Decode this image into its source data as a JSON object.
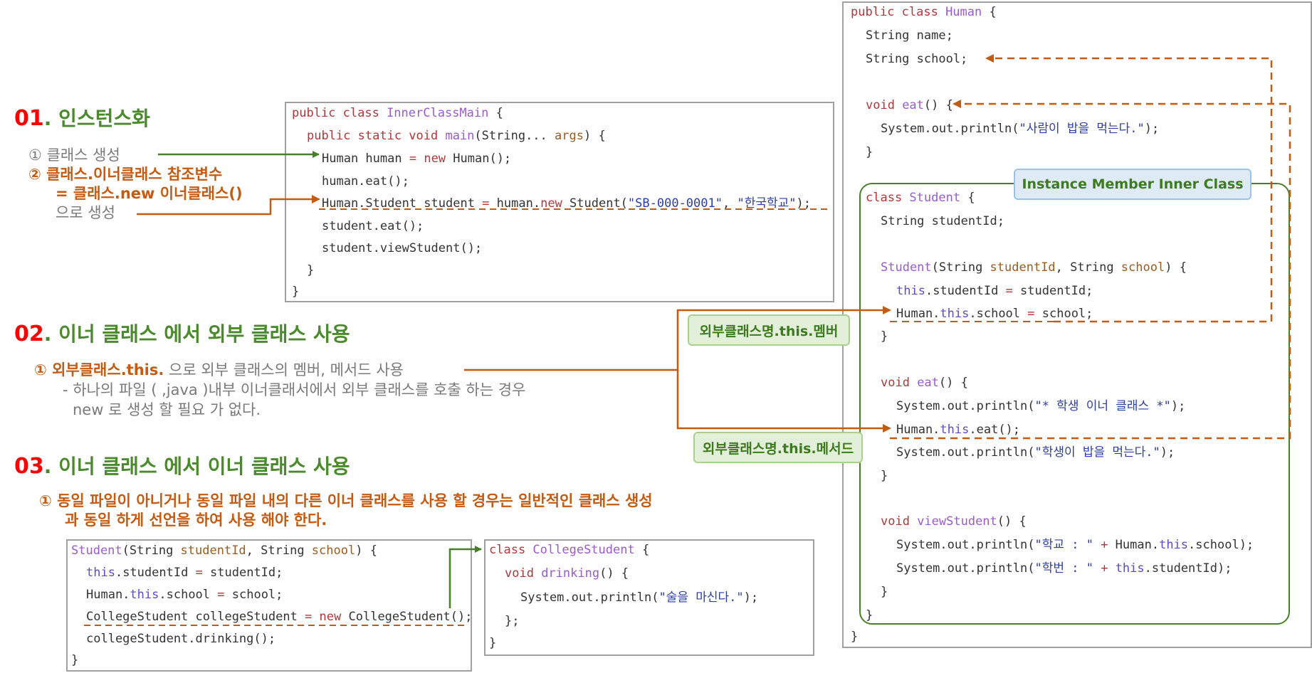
{
  "sections": {
    "s1": {
      "num": "01",
      "title": ". 인스턴스화",
      "item1": "① 클래스 생성",
      "item2_line1": "② 클래스.이너클래스 참조변수",
      "item2_line2": "= 클래스.new 이너클래스()",
      "item2_line3": "으로 생성"
    },
    "s2": {
      "num": "02",
      "title": ". 이너 클래스 에서 외부 클래스 사용",
      "item1_prefix": "① 외부클래스.this.",
      "item1_rest": " 으로 외부 클래스의 멤버, 메서드 사용",
      "note1": "- 하나의 파일 ( ,java )내부 이너클래서에서 외부 클래스를 호출 하는 경우",
      "note2": "new 로 생성 할 필요 가 없다."
    },
    "s3": {
      "num": "03",
      "title": ". 이너 클래스 에서 이너 클래스 사용",
      "item1_line1": "① 동일 파일이 아니거나 동일 파일 내의 다른 이너 클래스를 사용 할 경우는 일반적인 클래스 생성",
      "item1_line2": "과 동일 하게 선언을 하여 사용 해야 한다."
    }
  },
  "labels": {
    "instance_inner": "Instance Member Inner Class",
    "outer_member": "외부클래스명.this.멤버",
    "outer_method": "외부클래스명.this.메서드"
  },
  "code": {
    "main": {
      "l1": [
        "public class ",
        "InnerClassMain",
        " {"
      ],
      "l2": [
        "public static void ",
        "main",
        "(String... ",
        "args",
        ") {"
      ],
      "l3": [
        "Human human ",
        "=",
        " ",
        "new",
        " Human();"
      ],
      "l4": "human.eat();",
      "l5": [
        "Human.Student student ",
        "=",
        " human.",
        "new",
        " Student(",
        "\"SB-000-0001\"",
        ", ",
        "\"한국학교\"",
        ");"
      ],
      "l6": "student.eat();",
      "l7": "student.viewStudent();",
      "l8": "}",
      "l9": "}"
    },
    "human": {
      "l1": [
        "public class ",
        "Human",
        " {"
      ],
      "l2": "String name;",
      "l3": "String school;",
      "l4": [
        "void ",
        "eat",
        "() {"
      ],
      "l5": [
        "System.out.println(",
        "\"사람이 밥을 먹는다.\"",
        ");"
      ],
      "l6": "}",
      "l7": [
        "class ",
        "Student",
        " {"
      ],
      "l8": "String studentId;",
      "l9": [
        "Student",
        "(String ",
        "studentId",
        ", String ",
        "school",
        ") {"
      ],
      "l10": [
        "this",
        ".studentId ",
        "=",
        " studentId;"
      ],
      "l11": [
        "Human.",
        "this",
        ".school ",
        "=",
        " school;"
      ],
      "l12": "}",
      "l13": [
        "void ",
        "eat",
        "() {"
      ],
      "l14": [
        "System.out.println(",
        "\"* 학생 이너 클래스 *\"",
        ");"
      ],
      "l15": [
        "Human.",
        "this",
        ".eat();"
      ],
      "l16": [
        "System.out.println(",
        "\"학생이 밥을 먹는다.\"",
        ");"
      ],
      "l17": "}",
      "l18": [
        "void ",
        "viewStudent",
        "() {"
      ],
      "l19": [
        "System.out.println(",
        "\"학교 : \"",
        " ",
        "+",
        " Human.",
        "this",
        ".school);"
      ],
      "l20": [
        "System.out.println(",
        "\"학번 : \"",
        " ",
        "+",
        " ",
        "this",
        ".studentId);"
      ],
      "l21": "}",
      "l22": "}",
      "l23": "}"
    },
    "student": {
      "l1": [
        "Student",
        "(String ",
        "studentId",
        ", String ",
        "school",
        ") {"
      ],
      "l2": [
        "this",
        ".studentId ",
        "=",
        " studentId;"
      ],
      "l3": [
        "Human.",
        "this",
        ".school ",
        "=",
        " school;"
      ],
      "l4": [
        "CollegeStudent collegeStudent ",
        "=",
        " ",
        "new",
        " CollegeStudent();"
      ],
      "l5": "collegeStudent.drinking();",
      "l6": "}"
    },
    "college": {
      "l1": [
        "class ",
        "CollegeStudent",
        " {"
      ],
      "l2": [
        "void ",
        "drinking",
        "() {"
      ],
      "l3": [
        "System.out.println(",
        "\"술을 마신다.\"",
        ");"
      ],
      "l4": "};",
      "l5": "}"
    }
  },
  "colors": {
    "section_number": "#ff0000",
    "section_title": "#4a8a2c",
    "arrow_green": "#4a7f2a",
    "arrow_orange": "#c55a11",
    "keyword": "#b0373a",
    "type": "#9a5bd0",
    "string": "#2b3fa6"
  }
}
